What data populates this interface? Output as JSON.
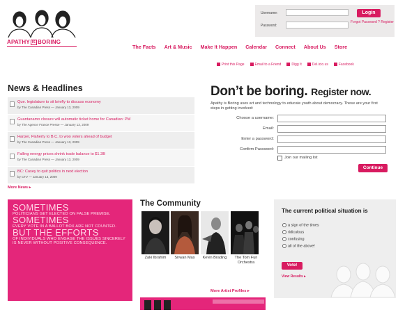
{
  "brand": {
    "prefix": "APATHY",
    "is": "IS",
    "suffix": "BORING",
    "accent": "#d81b60"
  },
  "login": {
    "username_label": "Username:",
    "password_label": "Password:",
    "login_label": "Login",
    "forgot_label": "Forgot Password ? Register"
  },
  "nav": {
    "items": [
      "The Facts",
      "Art & Music",
      "Make It Happen",
      "Calendar",
      "Connect",
      "About Us",
      "Store"
    ]
  },
  "utility": {
    "items": [
      {
        "label": "Print this Page",
        "icon": "print-icon"
      },
      {
        "label": "Email to a Friend",
        "icon": "email-icon"
      },
      {
        "label": "Digg It",
        "icon": "digg-icon"
      },
      {
        "label": "Del.icio.us",
        "icon": "delicious-icon"
      },
      {
        "label": "Facebook",
        "icon": "facebook-icon"
      }
    ]
  },
  "news": {
    "title": "News & Headlines",
    "items": [
      {
        "headline": "Que. legislature to sit briefly to discuss economy",
        "source": "by The Canadian Press — January 13, 2009"
      },
      {
        "headline": "Guantanamo closure will automatic ticket home for Canadian: PM",
        "source": "by The Agence France Presse — January 13, 2009"
      },
      {
        "headline": "Harper, Flaherty to B.C. to woo voters ahead of budget",
        "source": "by The Canadian Press — January 13, 2009"
      },
      {
        "headline": "Falling energy prices shrink trade balance to $1.3B",
        "source": "by The Canadian Press — January 13, 2009"
      },
      {
        "headline": "BC: Casey to quit politics in next election",
        "source": "by CTV — January 13, 2009"
      }
    ],
    "more_label": "More News ▸"
  },
  "register": {
    "title": "Don’t be boring.",
    "title_small": "Register now.",
    "intro": "Apathy is Boring uses art and technology to educate youth about democracy. These are your first steps in getting involved:",
    "fields": [
      "Choose a username:",
      "Email:",
      "Enter a password:",
      "Confirm Password:"
    ],
    "mailing_label": "Join our mailing list",
    "continue_label": "Continue"
  },
  "promo": {
    "line1": "SOMETIMES",
    "line2": "POLITICIANS GET ELECTED ON FALSE PREMISE.",
    "line3": "SOMETIMES",
    "line4": "EVERY VOTE IN A BALLOT BOX ARE NOT COUNTED.",
    "line5": "BUT THE EFFORTS",
    "line6": "OF INDIVIDUALS WHO ENGAGE THE ISSUES SINCERELY IS NEVER WITHOUT POSITIVE CONSEQUENCE."
  },
  "community": {
    "title": "The Community",
    "artists": [
      {
        "name": "Zaki Ibrahim"
      },
      {
        "name": "Sirwan Mas"
      },
      {
        "name": "Kevin Brading"
      },
      {
        "name": "The Tom Fun Orchestra"
      }
    ],
    "more_label": "More Artist Profiles ▸"
  },
  "poll": {
    "title": "The current political situation is",
    "options": [
      "a sign of the times",
      "ridiculous",
      "confusing",
      "all of the above!"
    ],
    "vote_label": "Vote!",
    "results_label": "View Results ▸"
  }
}
